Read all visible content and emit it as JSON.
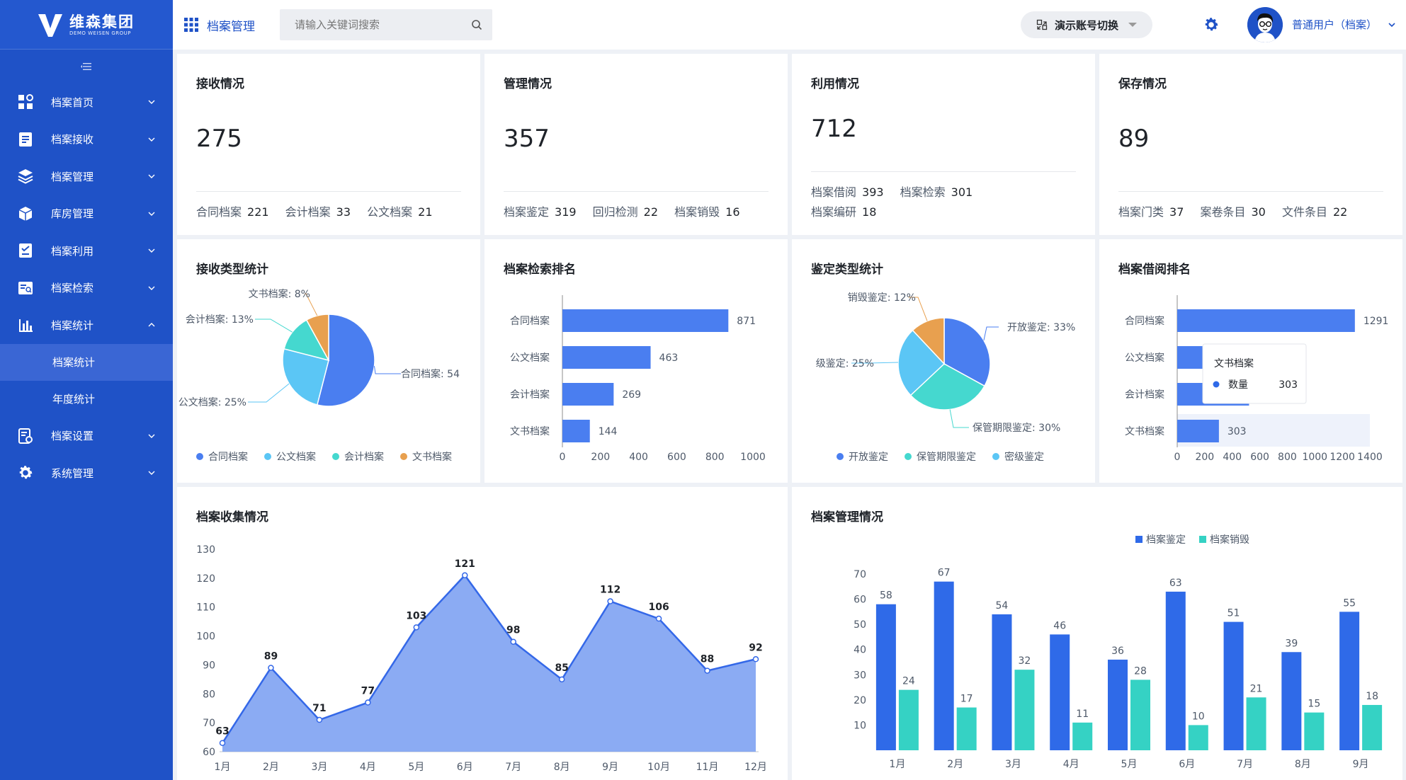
{
  "brand": {
    "name": "维森集团",
    "sub": "DEMO WEISEN GROUP"
  },
  "header": {
    "title": "档案管理",
    "search_placeholder": "请输入关键词搜索",
    "switch_label": "演示账号切换",
    "user_label": "普通用户（档案）"
  },
  "sidebar": {
    "items": [
      {
        "label": "档案首页",
        "icon": "dashboard-icon",
        "expanded": false
      },
      {
        "label": "档案接收",
        "icon": "inbox-icon",
        "expanded": false
      },
      {
        "label": "档案管理",
        "icon": "layers-icon",
        "expanded": false
      },
      {
        "label": "库房管理",
        "icon": "box-icon",
        "expanded": false
      },
      {
        "label": "档案利用",
        "icon": "checklist-icon",
        "expanded": false
      },
      {
        "label": "档案检索",
        "icon": "search-doc-icon",
        "expanded": false
      },
      {
        "label": "档案统计",
        "icon": "bar-chart-icon",
        "expanded": true,
        "children": [
          "档案统计",
          "年度统计"
        ]
      },
      {
        "label": "档案设置",
        "icon": "doc-settings-icon",
        "expanded": false
      },
      {
        "label": "系统管理",
        "icon": "gear-icon",
        "expanded": false
      }
    ],
    "active_child": "档案统计"
  },
  "summary": [
    {
      "title": "接收情况",
      "value": "275",
      "stats": [
        [
          "合同档案",
          "221"
        ],
        [
          "会计档案",
          "33"
        ],
        [
          "公文档案",
          "21"
        ]
      ]
    },
    {
      "title": "管理情况",
      "value": "357",
      "stats": [
        [
          "档案鉴定",
          "319"
        ],
        [
          "回归检测",
          "22"
        ],
        [
          "档案销毁",
          "16"
        ]
      ]
    },
    {
      "title": "利用情况",
      "value": "712",
      "stats": [
        [
          "档案借阅",
          "393"
        ],
        [
          "档案检索",
          "301"
        ]
      ],
      "stats2": [
        [
          "档案编研",
          "18"
        ]
      ]
    },
    {
      "title": "保存情况",
      "value": "89",
      "stats": [
        [
          "档案门类",
          "37"
        ],
        [
          "案卷条目",
          "30"
        ],
        [
          "文件条目",
          "22"
        ]
      ]
    }
  ],
  "colors": {
    "blue": "#4a7ef0",
    "light_blue": "#5bc6f5",
    "teal": "#45d8cf",
    "orange": "#e8a04f",
    "bar_blue": "#2f6ae8",
    "bar_teal": "#35d2c4",
    "area": "#7ea2f2"
  },
  "chart_data": [
    {
      "type": "pie",
      "title": "接收类型统计",
      "slices": [
        {
          "name": "合同档案",
          "value": 54,
          "label": "合同档案: 54",
          "color": "#4a7ef0"
        },
        {
          "name": "公文档案",
          "value": 25,
          "label": "公文档案: 25%",
          "color": "#5bc6f5"
        },
        {
          "name": "会计档案",
          "value": 13,
          "label": "会计档案: 13%",
          "color": "#45d8cf"
        },
        {
          "name": "文书档案",
          "value": 8,
          "label": "文书档案: 8%",
          "color": "#e8a04f"
        }
      ],
      "legend": [
        "合同档案",
        "公文档案",
        "会计档案",
        "文书档案"
      ]
    },
    {
      "type": "bar",
      "orientation": "horizontal",
      "title": "档案检索排名",
      "categories": [
        "合同档案",
        "公文档案",
        "会计档案",
        "文书档案"
      ],
      "values": [
        871,
        463,
        269,
        144
      ],
      "xlim": [
        0,
        1000
      ],
      "ticks": [
        "0",
        "200",
        "400",
        "600",
        "800",
        "1000"
      ]
    },
    {
      "type": "pie",
      "title": "鉴定类型统计",
      "slices": [
        {
          "name": "开放鉴定",
          "value": 33,
          "label": "开放鉴定: 33%",
          "color": "#4a7ef0"
        },
        {
          "name": "保管期限鉴定",
          "value": 30,
          "label": "保管期限鉴定: 30%",
          "color": "#45d8cf"
        },
        {
          "name": "密级鉴定",
          "value": 25,
          "label": "级鉴定: 25%",
          "color": "#5bc6f5"
        },
        {
          "name": "销毁鉴定",
          "value": 12,
          "label": "销毁鉴定: 12%",
          "color": "#e8a04f"
        }
      ],
      "legend": [
        "开放鉴定",
        "保管期限鉴定",
        "密级鉴定"
      ]
    },
    {
      "type": "bar",
      "orientation": "horizontal",
      "title": "档案借阅排名",
      "categories": [
        "合同档案",
        "公文档案",
        "会计档案",
        "文书档案"
      ],
      "values": [
        1291,
        679,
        522,
        303
      ],
      "xlim": [
        0,
        1400
      ],
      "ticks": [
        "0",
        "200",
        "400",
        "600",
        "800",
        "1000",
        "1200",
        "1400"
      ],
      "tooltip": {
        "title": "文书档案",
        "series": "数量",
        "value": "303"
      }
    },
    {
      "type": "area",
      "title": "档案收集情况",
      "categories": [
        "1月",
        "2月",
        "3月",
        "4月",
        "5月",
        "6月",
        "7月",
        "8月",
        "9月",
        "10月",
        "11月",
        "12月"
      ],
      "values": [
        63,
        89,
        71,
        77,
        103,
        121,
        98,
        85,
        112,
        106,
        88,
        92
      ],
      "ylim": [
        60,
        130
      ],
      "yticks": [
        "60",
        "70",
        "80",
        "90",
        "100",
        "110",
        "120",
        "130"
      ]
    },
    {
      "type": "bar",
      "title": "档案管理情况",
      "categories": [
        "1月",
        "2月",
        "3月",
        "4月",
        "5月",
        "6月",
        "7月",
        "8月",
        "9月"
      ],
      "series": [
        {
          "name": "档案鉴定",
          "values": [
            58,
            67,
            54,
            46,
            36,
            63,
            51,
            39,
            55
          ]
        },
        {
          "name": "档案销毁",
          "values": [
            24,
            17,
            32,
            11,
            28,
            10,
            21,
            15,
            18
          ]
        }
      ],
      "ylim": [
        0,
        70
      ],
      "yticks": [
        "10",
        "20",
        "30",
        "40",
        "50",
        "60",
        "70"
      ]
    }
  ]
}
